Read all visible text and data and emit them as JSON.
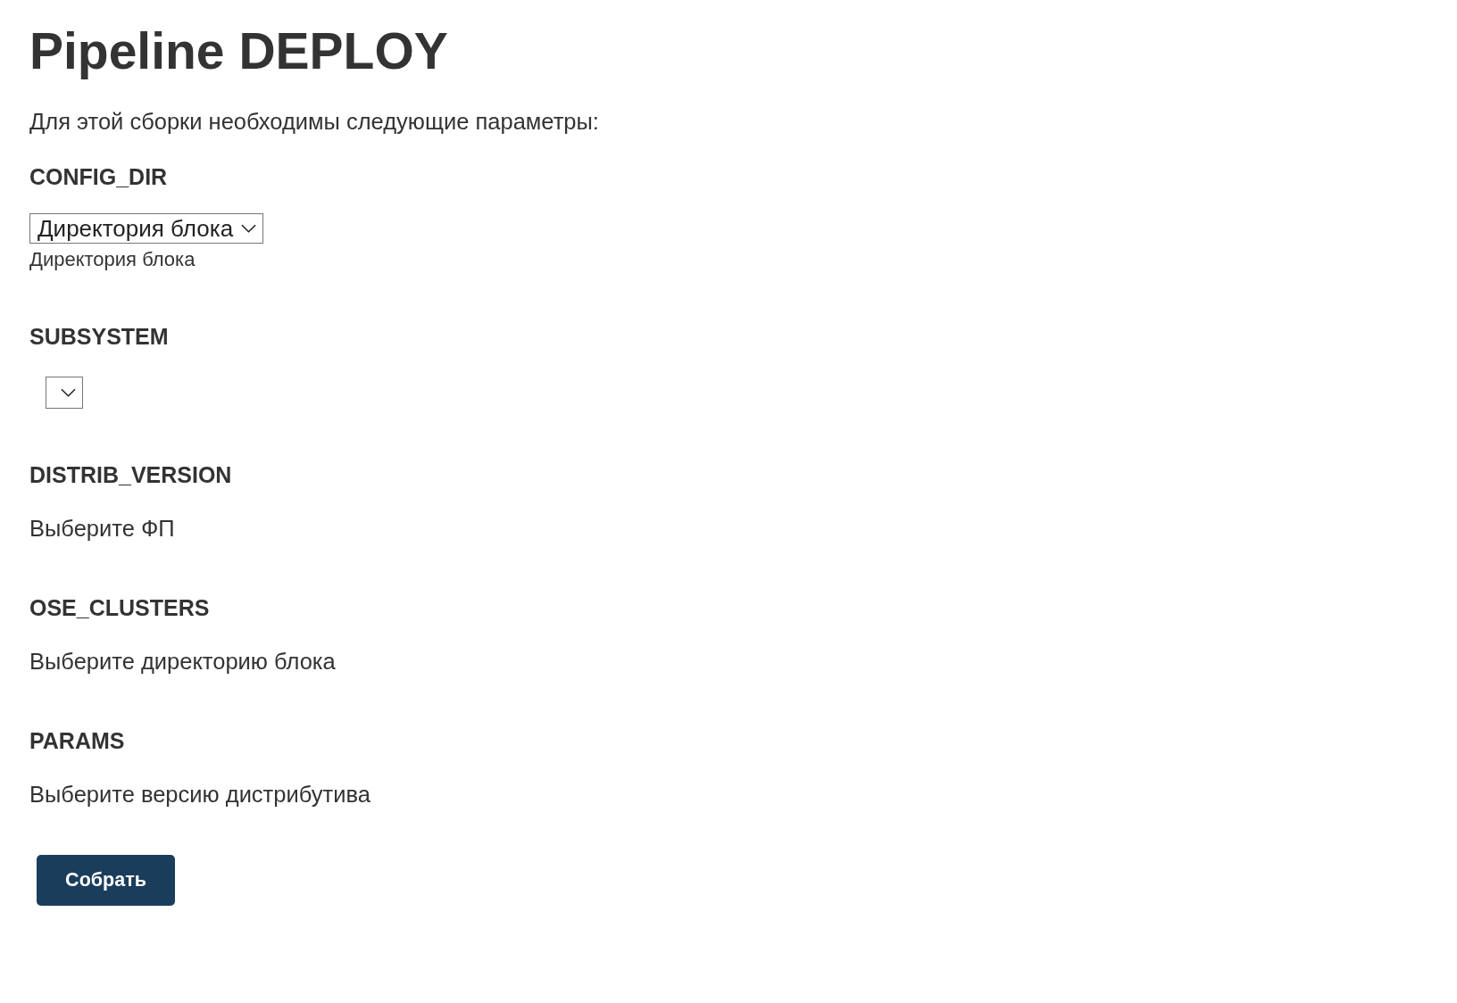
{
  "title": "Pipeline DEPLOY",
  "intro": "Для этой сборки необходимы следующие параметры:",
  "parameters": [
    {
      "name": "CONFIG_DIR",
      "kind": "select",
      "value": "Директория блока",
      "description": "Директория блока"
    },
    {
      "name": "SUBSYSTEM",
      "kind": "select"
    },
    {
      "name": "DISTRIB_VERSION",
      "kind": "message",
      "message": "Выберите ФП"
    },
    {
      "name": "OSE_CLUSTERS",
      "kind": "message",
      "message": "Выберите директорию блока"
    },
    {
      "name": "PARAMS",
      "kind": "message",
      "message": "Выберите версию дистрибутива"
    }
  ],
  "submit_button": "Собрать"
}
